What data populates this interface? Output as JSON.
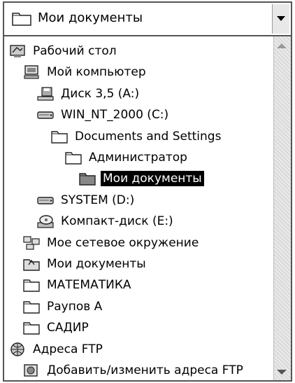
{
  "combo": {
    "value": "Мои документы",
    "icon": "folder-icon"
  },
  "tree": {
    "items": [
      {
        "label": "Рабочий стол",
        "icon": "desktop-icon",
        "level": 0,
        "selected": false
      },
      {
        "label": "Мой компьютер",
        "icon": "computer-icon",
        "level": 1,
        "selected": false
      },
      {
        "label": "Диск 3,5 (A:)",
        "icon": "floppy-icon",
        "level": 2,
        "selected": false
      },
      {
        "label": "WIN_NT_2000 (C:)",
        "icon": "hard-drive-icon",
        "level": 2,
        "selected": false
      },
      {
        "label": "Documents and Settings",
        "icon": "folder-icon",
        "level": 3,
        "selected": false
      },
      {
        "label": "Администратор",
        "icon": "folder-icon",
        "level": 4,
        "selected": false
      },
      {
        "label": "Мои документы",
        "icon": "folder-icon",
        "level": 5,
        "selected": true
      },
      {
        "label": "SYSTEM (D:)",
        "icon": "hard-drive-icon",
        "level": 2,
        "selected": false
      },
      {
        "label": "Компакт-диск (E:)",
        "icon": "cd-drive-icon",
        "level": 2,
        "selected": false
      },
      {
        "label": "Мое сетевое окружение",
        "icon": "network-icon",
        "level": 1,
        "selected": false
      },
      {
        "label": "Мои документы",
        "icon": "my-documents-icon",
        "level": 1,
        "selected": false
      },
      {
        "label": "МАТЕМАТИКА",
        "icon": "folder-icon",
        "level": 1,
        "selected": false
      },
      {
        "label": "Раупов А",
        "icon": "folder-icon",
        "level": 1,
        "selected": false
      },
      {
        "label": "САДИР",
        "icon": "folder-icon",
        "level": 1,
        "selected": false
      },
      {
        "label": "Адреса FTP",
        "icon": "ftp-icon",
        "level": 0,
        "selected": false
      },
      {
        "label": "Добавить/изменить адреса FTP",
        "icon": "ftp-edit-icon",
        "level": 1,
        "selected": false
      }
    ]
  }
}
